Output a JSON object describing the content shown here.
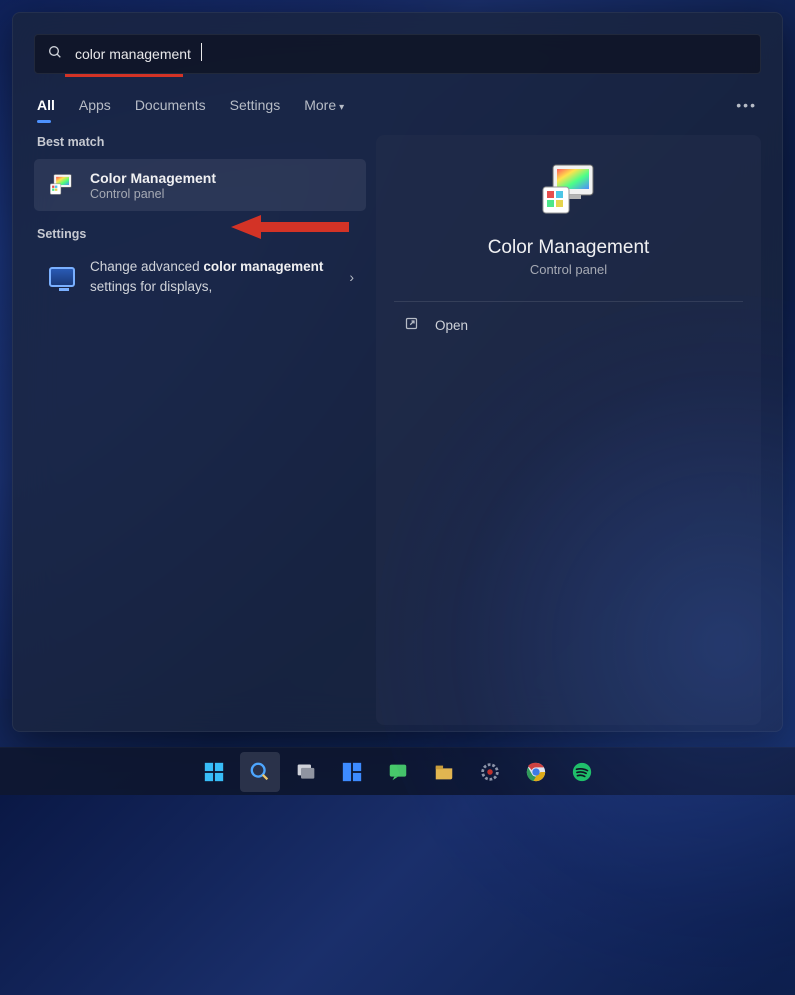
{
  "search": {
    "query": "color management"
  },
  "tabs": {
    "all": "All",
    "apps": "Apps",
    "documents": "Documents",
    "settings": "Settings",
    "more": "More"
  },
  "sections": {
    "best_match": "Best match",
    "settings": "Settings"
  },
  "results": {
    "best_match": {
      "title": "Color Management",
      "subtitle": "Control panel"
    },
    "setting_item": {
      "pre": "Change advanced ",
      "bold1": "color",
      "mid": " ",
      "bold2": "management",
      "post": " settings for displays,"
    }
  },
  "preview": {
    "title": "Color Management",
    "subtitle": "Control panel",
    "open_label": "Open"
  }
}
